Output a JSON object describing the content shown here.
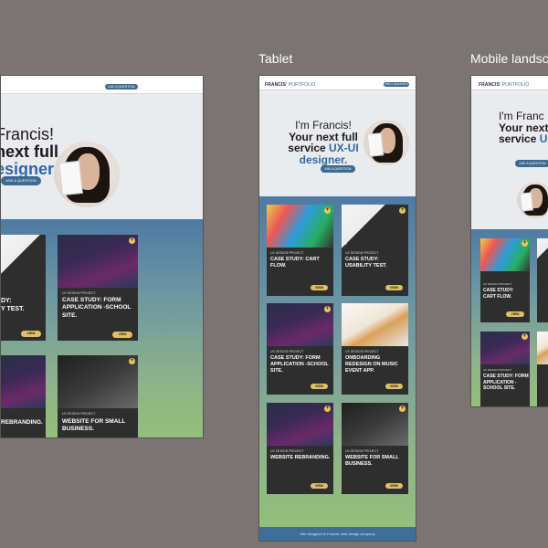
{
  "frames": {
    "desktop_label": "",
    "tablet_label": "Tablet",
    "mobile_label": "Mobile landsc"
  },
  "site": {
    "brand_bold": "FRANCIS'",
    "brand_light": " PORTFOLIO",
    "nav_cta": "ASK A QUESTION",
    "hero_cta": "ASK A QUESTION",
    "footer_text": "Site designed in Francis' web design company"
  },
  "hero_desktop": {
    "line1": "Francis!",
    "line2": "next full",
    "line3": "esigner."
  },
  "hero_tablet": {
    "line1": "I'm Francis!",
    "line2": "Your next full",
    "line3_pre": "service ",
    "line3_accent": "UX-UI",
    "line4": "designer."
  },
  "hero_mobile": {
    "line1": "I'm Franc",
    "line2": "Your next",
    "line3_pre": "service ",
    "line3_accent": "UX"
  },
  "desktop_cards": [
    {
      "kind": "",
      "title": "Y TEST.",
      "view": "VIEW"
    },
    {
      "kind": "UX DESIGN PROJECT",
      "title": "CASE STUDY: FORM APPLICATION -SCHOOL SITE.",
      "view": "VIEW"
    },
    {
      "kind": "",
      "title": "REBRANDING.",
      "view": ""
    },
    {
      "kind": "UX DESIGN PROJECT",
      "title": "WEBSITE FOR SMALL BUSINESS.",
      "view": ""
    }
  ],
  "desktop_partial": {
    "title_prefix": "DY:"
  },
  "tablet_cards": [
    {
      "kind": "UX DESIGN PROJECT",
      "title": "CASE STUDY: CART FLOW.",
      "view": "VIEW"
    },
    {
      "kind": "UX DESIGN PROJECT",
      "title": "CASE STUDY: USABILITY TEST.",
      "view": "VIEW"
    },
    {
      "kind": "UX DESIGN PROJECT",
      "title": "CASE STUDY: FORM APPLICATION -SCHOOL SITE.",
      "view": "VIEW"
    },
    {
      "kind": "UX DESIGN PROJECT",
      "title": "ONBOARDING REDESIGN ON MUSIC EVENT APP.",
      "view": "VIEW"
    },
    {
      "kind": "UX DESIGN PROJECT",
      "title": "WEBSITE REBRANDING.",
      "view": "VIEW"
    },
    {
      "kind": "UX DESIGN PROJECT",
      "title": "WEBSITE FOR SMALL BUSINESS.",
      "view": "VIEW"
    }
  ],
  "mobile_cards": [
    {
      "kind": "UX DESIGN PROJECT",
      "title": "CASE STUDY: CART FLOW.",
      "view": "VIEW"
    },
    {
      "kind": "UX DESIGN PROJECT",
      "title": "CASE STUDY: FORM APPLICATION - SCHOOL SITE.",
      "view": ""
    }
  ],
  "colors": {
    "canvas": "#7a7473",
    "accent": "#2f67a8",
    "button": "#3c6a91",
    "view_button": "#e0c065"
  }
}
